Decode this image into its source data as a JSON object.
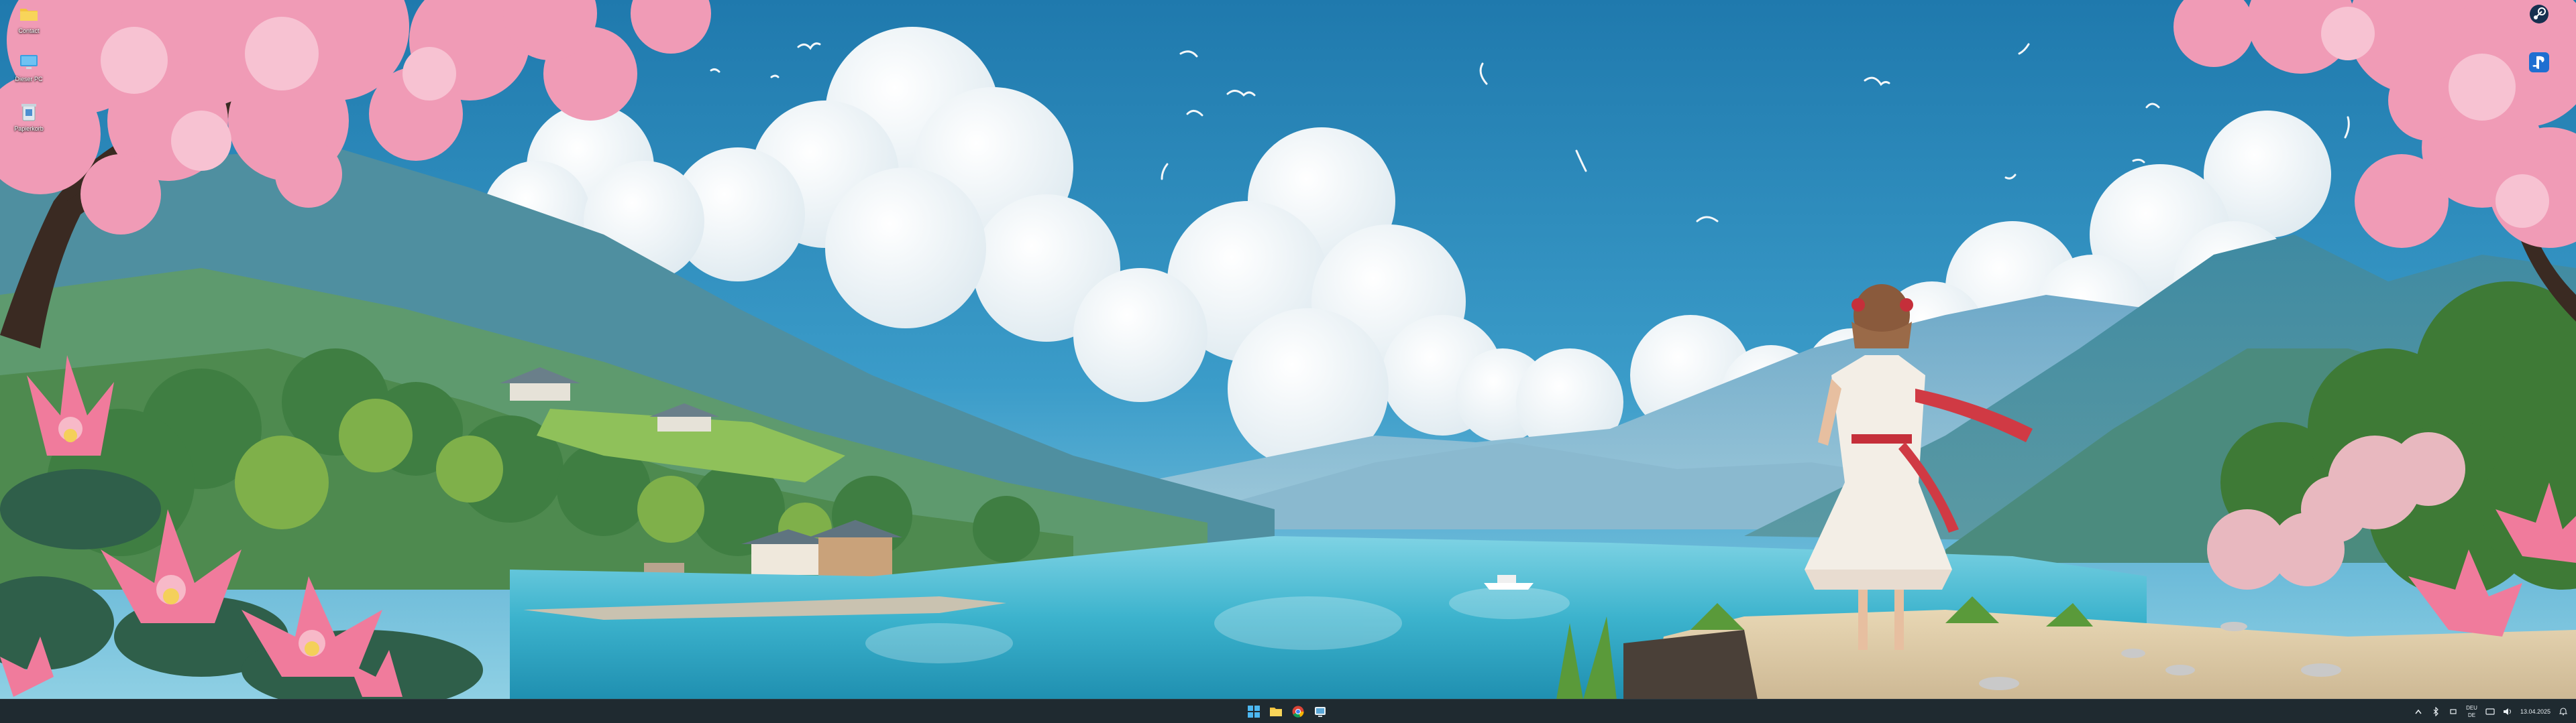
{
  "desktop": {
    "icons": [
      {
        "label": "Contact"
      },
      {
        "label": "Dieser PC"
      },
      {
        "label": "Papierkorb"
      }
    ]
  },
  "side_apps": [
    {
      "icon": "steam-icon"
    },
    {
      "icon": "playstation-icon"
    }
  ],
  "taskbar": {
    "pinned": [
      {
        "icon": "windows-start-icon"
      },
      {
        "icon": "file-explorer-icon"
      },
      {
        "icon": "chrome-icon"
      },
      {
        "icon": "desktop-app-icon"
      }
    ],
    "tray": {
      "language_top": "DEU",
      "language_bottom": "DE",
      "time": "",
      "date": "13.04.2025"
    }
  },
  "colors": {
    "sky": "#2a86b8",
    "lake": "#3fb6cf",
    "blossom": "#f09bb6",
    "taskbar": "#1f2a30"
  }
}
